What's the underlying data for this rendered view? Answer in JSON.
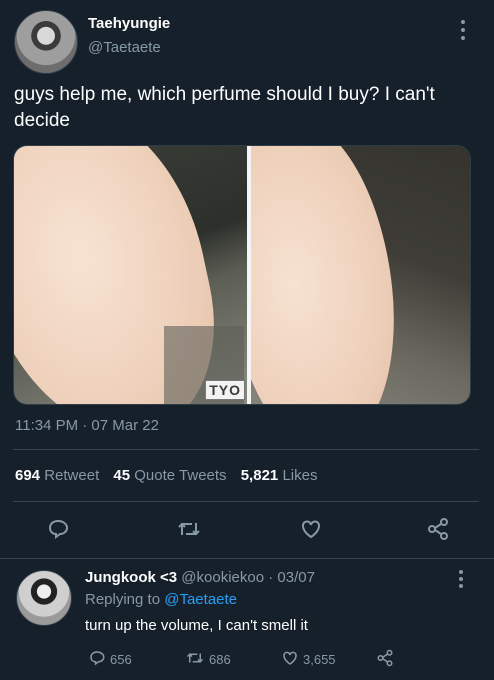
{
  "main_tweet": {
    "display_name": "Taehyungie",
    "handle": "@Taetaete",
    "text": "guys help me, which perfume should I buy? I can't decide",
    "watermark": "TYO",
    "timestamp": "11:34 PM · 07 Mar 22",
    "stats": {
      "retweets": "694",
      "retweets_label": "Retweet",
      "quotes": "45",
      "quotes_label": "Quote Tweets",
      "likes": "5,821",
      "likes_label": "Likes"
    }
  },
  "reply": {
    "display_name": "Jungkook <3",
    "handle_date": "@kookiekoo · 03/07",
    "replying_prefix": "Replying to",
    "replying_handle": "@Taetaete",
    "text": "turn up the volume, I can't smell it",
    "counts": {
      "replies": "656",
      "retweets": "686",
      "likes": "3,655"
    }
  },
  "icons": [
    "more-vertical-icon",
    "reply-icon",
    "retweet-icon",
    "like-icon",
    "share-icon"
  ],
  "colors": {
    "background": "#15202b",
    "muted": "#8899a6",
    "link": "#1da1f2",
    "divider": "#38444d"
  }
}
